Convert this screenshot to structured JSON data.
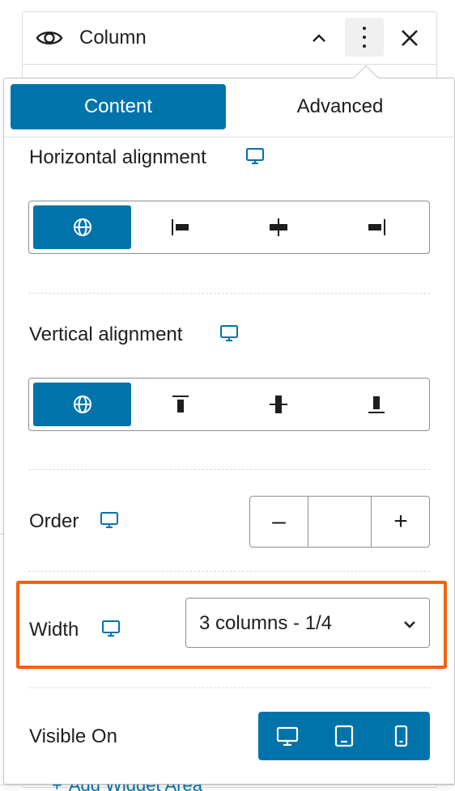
{
  "header": {
    "title": "Column",
    "icons": [
      "eye-icon",
      "chevron-up-icon",
      "more-vertical-icon",
      "close-icon"
    ]
  },
  "tabs": [
    {
      "label": "Content",
      "active": true
    },
    {
      "label": "Advanced",
      "active": false
    }
  ],
  "horizontal_alignment": {
    "label": "Horizontal alignment",
    "options": [
      "globe-icon",
      "align-left-icon",
      "align-center-icon",
      "align-right-icon"
    ],
    "selected": 0
  },
  "vertical_alignment": {
    "label": "Vertical alignment",
    "options": [
      "globe-icon",
      "align-top-icon",
      "align-middle-icon",
      "align-bottom-icon"
    ],
    "selected": 0
  },
  "order": {
    "label": "Order",
    "value": "",
    "minus": "–",
    "plus": "+"
  },
  "width": {
    "label": "Width",
    "selected": "3 columns - 1/4"
  },
  "visible_on": {
    "label": "Visible On",
    "devices": [
      "desktop-icon",
      "tablet-icon",
      "mobile-icon"
    ]
  },
  "background": {
    "add_widget_area": "Add Widget Area"
  },
  "colors": {
    "accent": "#0073aa",
    "highlight": "#f2620f"
  }
}
